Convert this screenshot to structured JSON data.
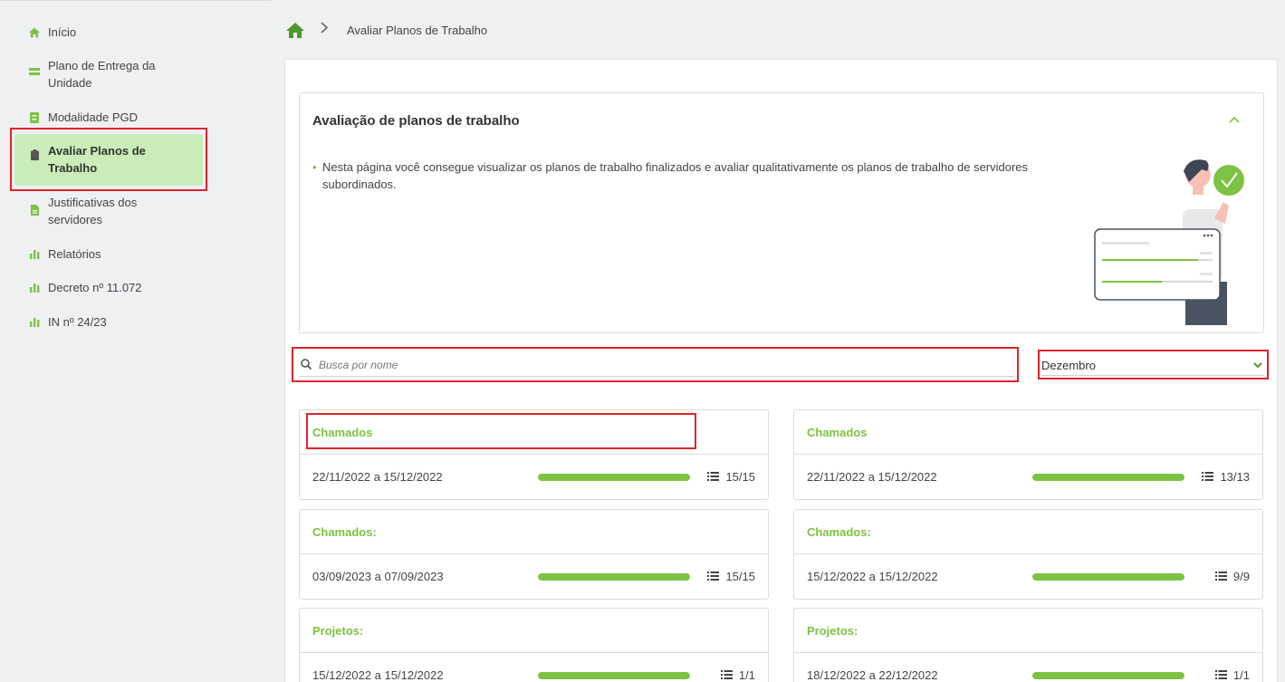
{
  "sidebar": {
    "items": [
      {
        "label": "Início",
        "icon": "home-icon"
      },
      {
        "label": "Plano de Entrega da Unidade",
        "icon": "card-icon"
      },
      {
        "label": "Modalidade PGD",
        "icon": "badge-icon"
      },
      {
        "label": "Avaliar Planos de Trabalho",
        "icon": "clipboard-icon",
        "active": true
      },
      {
        "label": "Justificativas dos servidores",
        "icon": "document-icon"
      },
      {
        "label": "Relatórios",
        "icon": "bar-chart-icon"
      },
      {
        "label": "Decreto nº 11.072",
        "icon": "bar-chart-icon"
      },
      {
        "label": "IN nº 24/23",
        "icon": "bar-chart-icon"
      }
    ]
  },
  "breadcrumb": {
    "current": "Avaliar Planos de Trabalho"
  },
  "info": {
    "title": "Avaliação de planos de trabalho",
    "text": "Nesta página você consegue visualizar os planos de trabalho finalizados e avaliar qualitativamente os planos de trabalho de servidores subordinados."
  },
  "search": {
    "placeholder": "Busca por nome"
  },
  "filter": {
    "month": "Dezembro"
  },
  "plans": [
    {
      "title": "Chamados",
      "dates": "22/11/2022 a 15/12/2022",
      "count": "15/15",
      "progress": 1.0
    },
    {
      "title": "Chamados",
      "dates": "22/11/2022 a 15/12/2022",
      "count": "13/13",
      "progress": 1.0
    },
    {
      "title": "Chamados:",
      "dates": "03/09/2023 a 07/09/2023",
      "count": "15/15",
      "progress": 1.0
    },
    {
      "title": "Chamados:",
      "dates": "15/12/2022 a 15/12/2022",
      "count": "9/9",
      "progress": 1.0
    },
    {
      "title": "Projetos:",
      "dates": "15/12/2022 a 15/12/2022",
      "count": "1/1",
      "progress": 1.0
    },
    {
      "title": "Projetos:",
      "dates": "18/12/2022 a 22/12/2022",
      "count": "1/1",
      "progress": 1.0
    }
  ],
  "colors": {
    "accent": "#7dc242",
    "active_bg": "#c9ecb9",
    "highlight": "#e0232b"
  }
}
